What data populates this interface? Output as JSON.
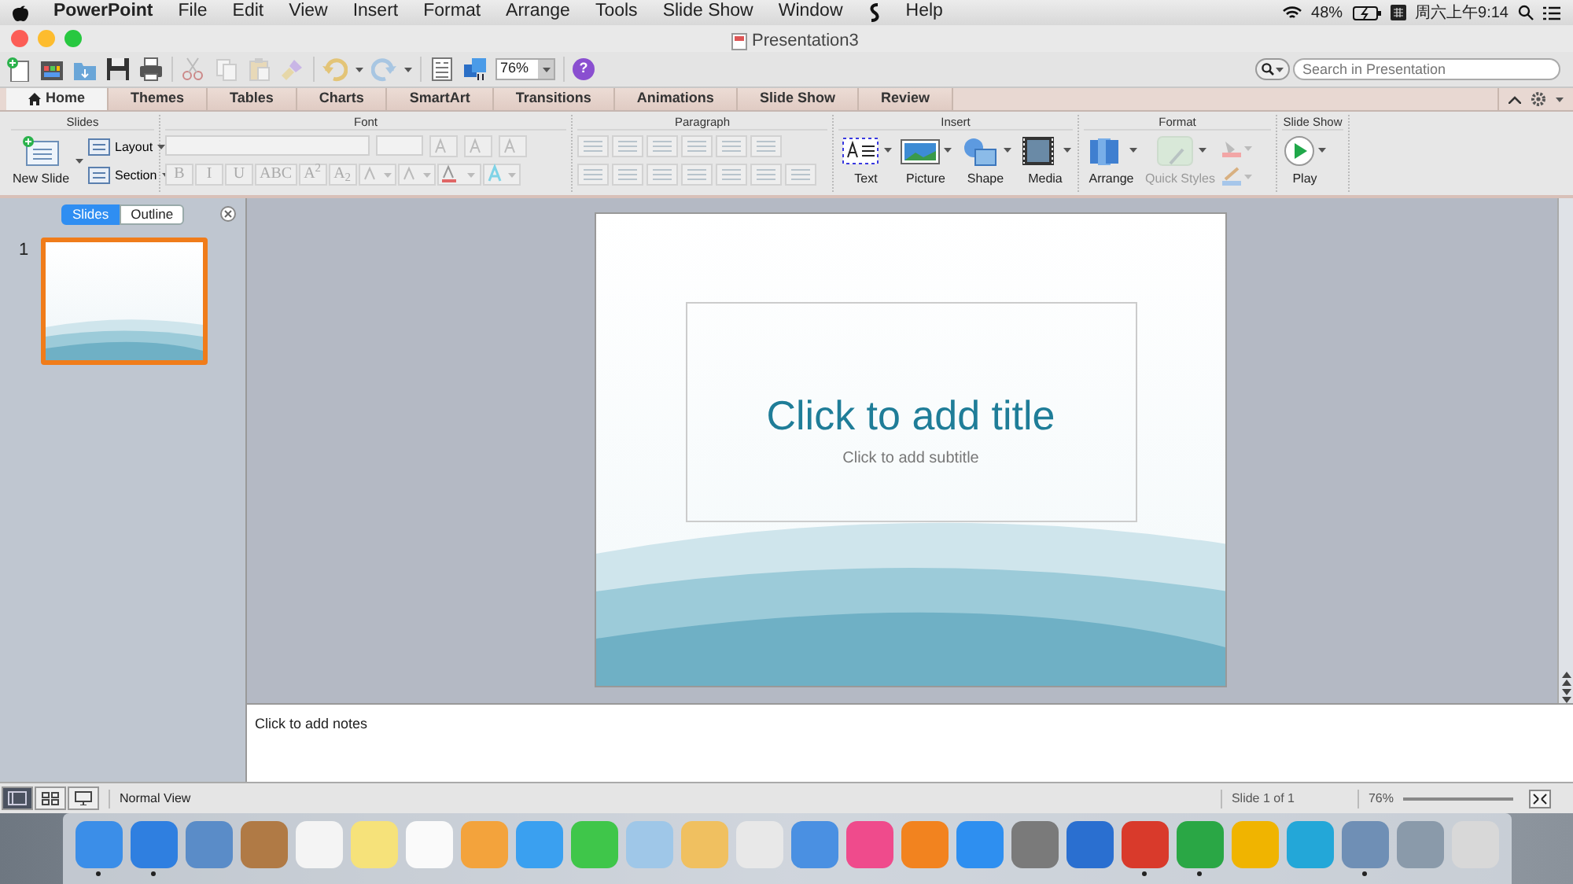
{
  "menubar": {
    "app": "PowerPoint",
    "items": [
      "File",
      "Edit",
      "View",
      "Insert",
      "Format",
      "Arrange",
      "Tools",
      "Slide Show",
      "Window"
    ],
    "items_after_script": [
      "Help"
    ],
    "battery": "48%",
    "clock": "周六上午9:14"
  },
  "window": {
    "title": "Presentation3"
  },
  "toolbar": {
    "zoom": "76%",
    "help": "?",
    "search": {
      "placeholder": "Search in Presentation"
    }
  },
  "ribbon_tabs": [
    {
      "label": "Home",
      "selected": true
    },
    {
      "label": "Themes",
      "selected": false
    },
    {
      "label": "Tables",
      "selected": false
    },
    {
      "label": "Charts",
      "selected": false
    },
    {
      "label": "SmartArt",
      "selected": false
    },
    {
      "label": "Transitions",
      "selected": false
    },
    {
      "label": "Animations",
      "selected": false
    },
    {
      "label": "Slide Show",
      "selected": false
    },
    {
      "label": "Review",
      "selected": false
    }
  ],
  "ribbon": {
    "slides": {
      "title": "Slides",
      "new_slide": "New Slide",
      "layout": "Layout",
      "section": "Section"
    },
    "font": {
      "title": "Font",
      "styles": [
        {
          "label": "B",
          "disabled": true
        },
        {
          "label": "I",
          "disabled": true
        },
        {
          "label": "U",
          "disabled": true
        },
        {
          "label": "ABC",
          "disabled": true
        },
        {
          "label": "A$^{2}$",
          "disabled": true
        },
        {
          "label": "A$_{2}$",
          "disabled": true
        }
      ]
    },
    "paragraph": {
      "title": "Paragraph"
    },
    "insert": {
      "title": "Insert",
      "buttons": [
        {
          "label": "Text",
          "kind": "text"
        },
        {
          "label": "Picture",
          "kind": "picture"
        },
        {
          "label": "Shape",
          "kind": "shape"
        },
        {
          "label": "Media",
          "kind": "media"
        }
      ]
    },
    "format": {
      "title": "Format",
      "buttons": [
        {
          "label": "Arrange",
          "kind": "arrange",
          "disabled": false
        },
        {
          "label": "Quick Styles",
          "kind": "styles",
          "disabled": true
        }
      ]
    },
    "slide_show": {
      "title": "Slide Show",
      "play": "Play"
    }
  },
  "left_pane": {
    "tabs": [
      {
        "label": "Slides",
        "selected": true
      },
      {
        "label": "Outline",
        "selected": false
      }
    ],
    "thumbnails": [
      {
        "number": "1",
        "selected": true
      }
    ]
  },
  "slide": {
    "title": "Click to add title",
    "subtitle": "Click to add subtitle"
  },
  "notes": {
    "placeholder": "Click to add notes"
  },
  "status_bar": {
    "views": [
      {
        "kind": "normal",
        "selected": true
      },
      {
        "kind": "sorter",
        "selected": false
      },
      {
        "kind": "show",
        "selected": false
      }
    ],
    "view_name": "Normal View",
    "slide_count": "Slide 1 of 1",
    "zoom": "76%"
  },
  "dock": [
    {
      "color": "#3b8ee8",
      "running": true
    },
    {
      "color": "#2f7fe0",
      "running": true
    },
    {
      "color": "#5a8cc8",
      "running": false
    },
    {
      "color": "#b07a45",
      "running": false
    },
    {
      "color": "#f4f4f4",
      "running": false
    },
    {
      "color": "#f6e27a",
      "running": false
    },
    {
      "color": "#fafafa",
      "running": false
    },
    {
      "color": "#f3a33c",
      "running": false
    },
    {
      "color": "#3aa0f0",
      "running": false
    },
    {
      "color": "#3fc64a",
      "running": false
    },
    {
      "color": "#9fc7e8",
      "running": false
    },
    {
      "color": "#f0c060",
      "running": false
    },
    {
      "color": "#e8e8e8",
      "running": false
    },
    {
      "color": "#4a90e2",
      "running": false
    },
    {
      "color": "#ef4b8c",
      "running": false
    },
    {
      "color": "#f2831f",
      "running": false
    },
    {
      "color": "#2e8ff0",
      "running": false
    },
    {
      "color": "#7a7a7a",
      "running": false
    },
    {
      "color": "#2a6fd0",
      "running": false
    },
    {
      "color": "#d93a2b",
      "running": true
    },
    {
      "color": "#2aa745",
      "running": true
    },
    {
      "color": "#f0b400",
      "running": false
    },
    {
      "color": "#23a7d8",
      "running": false
    },
    {
      "color": "#6f8fb5",
      "running": true
    },
    {
      "color": "#8a9aaa",
      "running": false
    },
    {
      "color": "#d8d8d8",
      "running": false
    }
  ]
}
